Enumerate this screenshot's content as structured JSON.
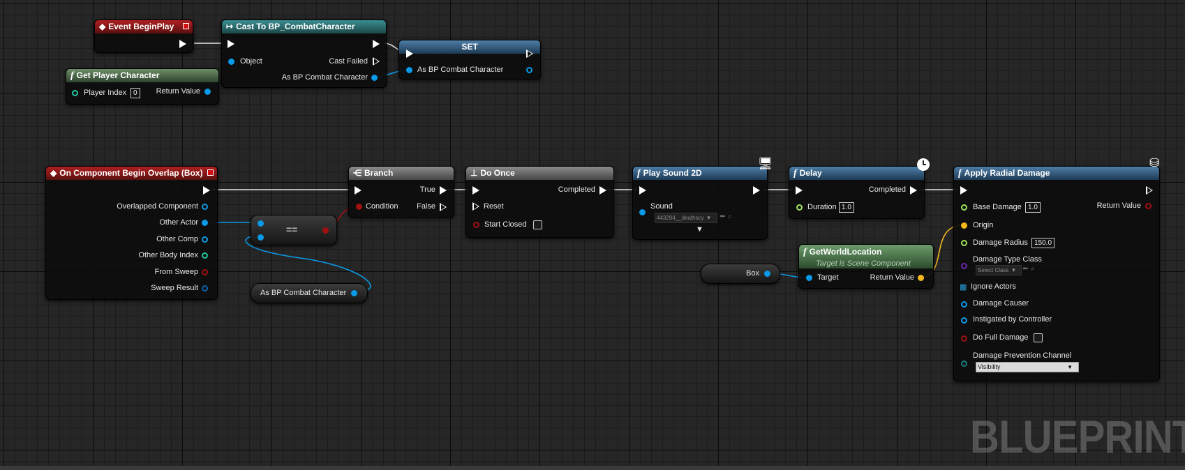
{
  "watermark": "BLUEPRINT",
  "nodes": {
    "event_begin_play": {
      "title": "Event BeginPlay"
    },
    "cast": {
      "title": "Cast To BP_CombatCharacter",
      "object": "Object",
      "cast_failed": "Cast Failed",
      "as_out": "As BP Combat Character"
    },
    "set": {
      "title": "SET",
      "as_in": "As BP Combat Character"
    },
    "get_player": {
      "title": "Get Player Character",
      "player_index": "Player Index",
      "player_index_value": "0",
      "return_value": "Return Value"
    },
    "overlap": {
      "title": "On Component Begin Overlap (Box)",
      "pins": [
        "Overlapped Component",
        "Other Actor",
        "Other Comp",
        "Other Body Index",
        "From Sweep",
        "Sweep Result"
      ]
    },
    "equals": {
      "label": "=="
    },
    "as_var": {
      "label": "As BP Combat Character"
    },
    "branch": {
      "title": "Branch",
      "condition": "Condition",
      "true": "True",
      "false": "False"
    },
    "do_once": {
      "title": "Do Once",
      "reset": "Reset",
      "start_closed": "Start Closed",
      "completed": "Completed"
    },
    "play_sound": {
      "title": "Play Sound 2D",
      "sound": "Sound",
      "sound_value": "443294__deathscy"
    },
    "delay": {
      "title": "Delay",
      "duration": "Duration",
      "duration_value": "1.0",
      "completed": "Completed"
    },
    "gwl": {
      "title": "GetWorldLocation",
      "subtitle": "Target is Scene Component",
      "target": "Target",
      "return_value": "Return Value"
    },
    "box_var": {
      "label": "Box"
    },
    "radial": {
      "title": "Apply Radial Damage",
      "base_damage": "Base Damage",
      "base_damage_value": "1.0",
      "origin": "Origin",
      "damage_radius": "Damage Radius",
      "damage_radius_value": "150.0",
      "damage_type_class": "Damage Type Class",
      "select_class": "Select Class",
      "ignore_actors": "Ignore Actors",
      "damage_causer": "Damage Causer",
      "instigated": "Instigated by Controller",
      "do_full_damage": "Do Full Damage",
      "prevention_channel": "Damage Prevention Channel",
      "channel_value": "Visibility",
      "return_value": "Return Value"
    }
  }
}
